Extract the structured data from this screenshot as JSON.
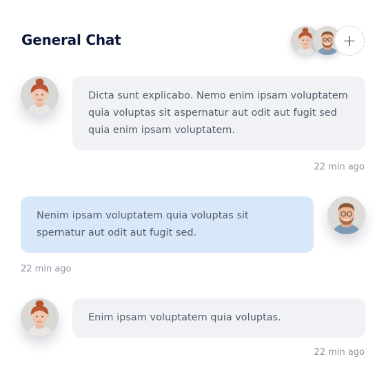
{
  "chat": {
    "title": "General Chat",
    "add_label": "+"
  },
  "messages": [
    {
      "direction": "incoming",
      "text": "Dicta sunt explicabo. Nemo enim ipsam voluptatem quia voluptas sit aspernatur aut odit aut fugit sed quia enim ipsam voluptatem.",
      "time": "22 min ago"
    },
    {
      "direction": "outgoing",
      "text": "Nenim ipsam voluptatem quia voluptas sit spernatur aut odit aut fugit sed.",
      "time": "22 min ago"
    },
    {
      "direction": "incoming",
      "text": "Enim ipsam voluptatem quia voluptas.",
      "time": "22 min ago"
    }
  ],
  "colors": {
    "title": "#0e1738",
    "incoming_bubble": "#f1f2f6",
    "outgoing_bubble": "#d9e8f8",
    "message_text": "#555b6b",
    "timestamp": "#8f94a0"
  }
}
